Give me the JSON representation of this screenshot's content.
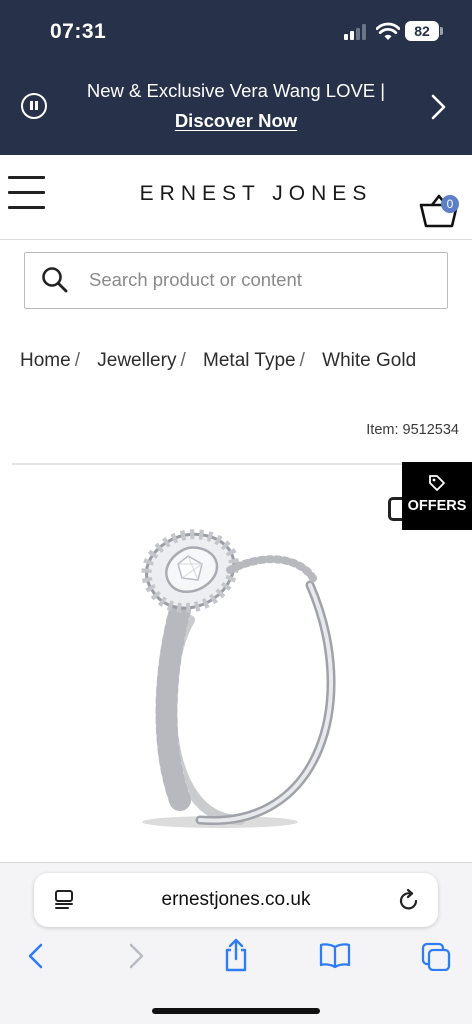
{
  "status": {
    "time": "07:31",
    "battery": "82"
  },
  "banner": {
    "text": "New & Exclusive Vera Wang LOVE |",
    "link": "Discover Now"
  },
  "header": {
    "logo": "ERNEST JONES",
    "basket_count": "0"
  },
  "search": {
    "placeholder": "Search product or content"
  },
  "breadcrumb": [
    "Home",
    "Jewellery",
    "Metal Type",
    "White Gold"
  ],
  "product": {
    "item_number": "Item: 9512534"
  },
  "offers": {
    "label": "OFFERS"
  },
  "browser": {
    "url": "ernestjones.co.uk"
  },
  "colors": {
    "banner_bg": "#27324a",
    "basket_badge": "#5c7fc7",
    "safari_blue": "#2f7cf6"
  },
  "icons": [
    "pause-icon",
    "chevron-right-icon",
    "hamburger-icon",
    "basket-icon",
    "search-icon",
    "tag-icon",
    "reader-icon",
    "reload-icon",
    "back-icon",
    "forward-icon",
    "share-icon",
    "bookmarks-icon",
    "tabs-icon"
  ]
}
